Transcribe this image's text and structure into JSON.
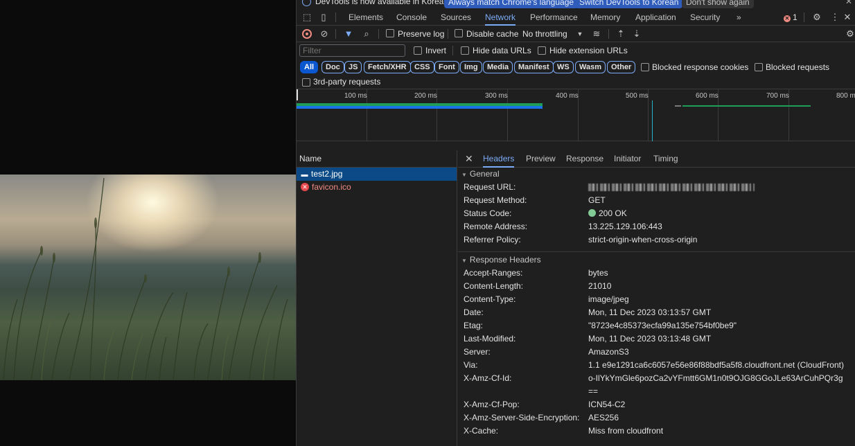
{
  "infobar": {
    "message": "DevTools is now available in Korean!",
    "match_button": "Always match Chrome's language",
    "switch_button": "Switch DevTools to Korean",
    "dismiss_button": "Don't show again"
  },
  "tabs": [
    "Elements",
    "Console",
    "Sources",
    "Network",
    "Performance",
    "Memory",
    "Application",
    "Security"
  ],
  "active_tab": "Network",
  "more_tabs": "»",
  "error_count": "1",
  "toolbar": {
    "preserve_log": "Preserve log",
    "disable_cache": "Disable cache",
    "throttling": "No throttling"
  },
  "filter": {
    "placeholder": "Filter",
    "invert": "Invert",
    "hide_data_urls": "Hide data URLs",
    "hide_extension_urls": "Hide extension URLs"
  },
  "type_filters": [
    "All",
    "Doc",
    "JS",
    "Fetch/XHR",
    "CSS",
    "Font",
    "Img",
    "Media",
    "Manifest",
    "WS",
    "Wasm",
    "Other"
  ],
  "blocked_response_cookies": "Blocked response cookies",
  "blocked_requests": "Blocked requests",
  "third_party": "3rd-party requests",
  "overview": {
    "ticks": [
      "100 ms",
      "200 ms",
      "300 ms",
      "400 ms",
      "500 ms",
      "600 ms",
      "700 ms",
      "800 ms"
    ]
  },
  "requests": {
    "header": "Name",
    "items": [
      {
        "name": "test2.jpg",
        "status": "selected"
      },
      {
        "name": "favicon.ico",
        "status": "error"
      }
    ]
  },
  "detail_tabs": [
    "Headers",
    "Preview",
    "Response",
    "Initiator",
    "Timing"
  ],
  "general": {
    "title": "General",
    "rows": [
      {
        "key": "Request URL:",
        "value": ""
      },
      {
        "key": "Request Method:",
        "value": "GET"
      },
      {
        "key": "Status Code:",
        "value": "200 OK"
      },
      {
        "key": "Remote Address:",
        "value": "13.225.129.106:443"
      },
      {
        "key": "Referrer Policy:",
        "value": "strict-origin-when-cross-origin"
      }
    ]
  },
  "response_headers": {
    "title": "Response Headers",
    "rows": [
      {
        "key": "Accept-Ranges:",
        "value": "bytes"
      },
      {
        "key": "Content-Length:",
        "value": "21010"
      },
      {
        "key": "Content-Type:",
        "value": "image/jpeg"
      },
      {
        "key": "Date:",
        "value": "Mon, 11 Dec 2023 03:13:57 GMT"
      },
      {
        "key": "Etag:",
        "value": "\"8723e4c85373ecfa99a135e754bf0be9\""
      },
      {
        "key": "Last-Modified:",
        "value": "Mon, 11 Dec 2023 03:13:48 GMT"
      },
      {
        "key": "Server:",
        "value": "AmazonS3"
      },
      {
        "key": "Via:",
        "value": "1.1 e9e1291ca6c6057e56e86f88bdf5a5f8.cloudfront.net (CloudFront)"
      },
      {
        "key": "X-Amz-Cf-Id:",
        "value": "o-IlYkYmGle6pozCa2vYFmtt6GM1n0t9OJG8GGoJLe63ArCuhPQr3g=="
      },
      {
        "key": "X-Amz-Cf-Pop:",
        "value": "ICN54-C2"
      },
      {
        "key": "X-Amz-Server-Side-Encryption:",
        "value": "AES256"
      },
      {
        "key": "X-Cache:",
        "value": "Miss from cloudfront"
      }
    ]
  },
  "colors": {
    "accent": "#7cacf8",
    "selected_row": "#0b4a86",
    "error": "#f28b82",
    "status_ok": "#81c995",
    "timeline_green": "#1e9e57",
    "timeline_blue": "#1a73e8"
  }
}
